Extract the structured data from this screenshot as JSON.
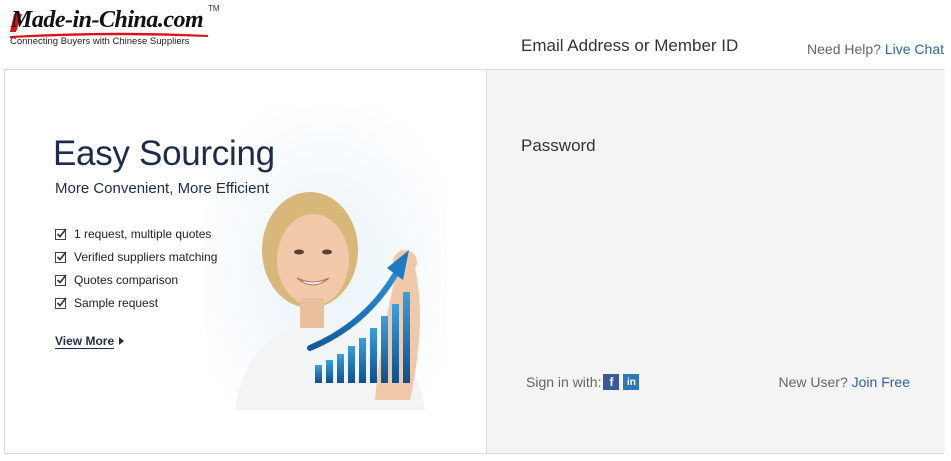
{
  "brand": {
    "logo_text": "Made-in-China.com",
    "trademark": "TM",
    "tagline": "Connecting Buyers with Chinese Suppliers"
  },
  "header": {
    "help_text": "Need Help?",
    "live_chat": "Live Chat"
  },
  "promo": {
    "title": "Easy Sourcing",
    "subtitle": "More Convenient, More Efficient",
    "features": [
      "1 request, multiple quotes",
      "Verified suppliers matching",
      "Quotes comparison",
      "Sample request"
    ],
    "view_more": "View More"
  },
  "form": {
    "email_label": "Email Address or Member ID",
    "password_label": "Password",
    "sign_in_with": "Sign in with:",
    "social": [
      {
        "name": "facebook-icon",
        "glyph": "f",
        "color": "#3b5998"
      },
      {
        "name": "linkedin-icon",
        "glyph": "in",
        "color": "#2e78b4"
      }
    ],
    "new_user": "New User?",
    "join_free": "Join Free"
  },
  "colors": {
    "accent": "#2f63a6",
    "heading": "#1e2b4a",
    "logo_red": "#d8121b",
    "form_bg": "#f4f4f4"
  }
}
